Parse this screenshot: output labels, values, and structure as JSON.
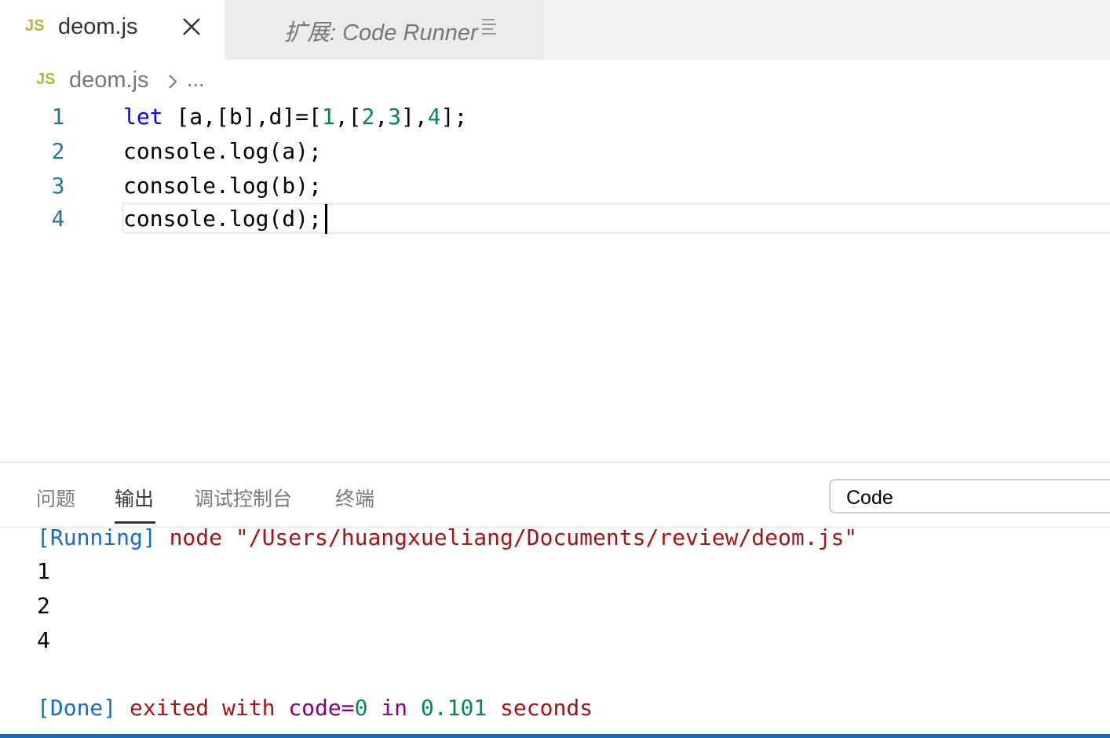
{
  "tabs": [
    {
      "badge": "JS",
      "label": "deom.js",
      "active": true
    },
    {
      "label": "扩展: Code Runner",
      "active": false,
      "icon": "preview-icon"
    }
  ],
  "breadcrumb": {
    "badge": "JS",
    "file": "deom.js",
    "more": "..."
  },
  "editor": {
    "lines": [
      {
        "number": "1",
        "tokens": [
          {
            "text": "let",
            "kind": "kw"
          },
          {
            "text": " [a,[b],d]=[",
            "kind": "plain"
          },
          {
            "text": "1",
            "kind": "num"
          },
          {
            "text": ",[",
            "kind": "plain"
          },
          {
            "text": "2",
            "kind": "num"
          },
          {
            "text": ",",
            "kind": "plain"
          },
          {
            "text": "3",
            "kind": "num"
          },
          {
            "text": "],",
            "kind": "plain"
          },
          {
            "text": "4",
            "kind": "num"
          },
          {
            "text": "];",
            "kind": "plain"
          }
        ]
      },
      {
        "number": "2",
        "tokens": [
          {
            "text": "console.log(a);",
            "kind": "plain"
          }
        ]
      },
      {
        "number": "3",
        "tokens": [
          {
            "text": "console.log(b);",
            "kind": "plain"
          }
        ]
      },
      {
        "number": "4",
        "tokens": [
          {
            "text": "console.log(d);",
            "kind": "plain"
          }
        ]
      }
    ]
  },
  "panel": {
    "tabs": [
      "问题",
      "输出",
      "调试控制台",
      "终端"
    ],
    "active_tab": "输出",
    "output_channel": "Code"
  },
  "output": {
    "running": {
      "tag": "[Running]",
      "command": " node \"/Users/huangxueliang/Documents/review/deom.js\""
    },
    "results": [
      "1",
      "2",
      "4"
    ],
    "done": [
      {
        "text": "[Done]",
        "kind": "blue"
      },
      {
        "text": " exited with ",
        "kind": "red"
      },
      {
        "text": "code=",
        "kind": "purple"
      },
      {
        "text": "0",
        "kind": "green"
      },
      {
        "text": " in ",
        "kind": "purple"
      },
      {
        "text": "0.101",
        "kind": "green"
      },
      {
        "text": " seconds",
        "kind": "red"
      }
    ]
  },
  "colors": {
    "keyword": "#0000ff",
    "number": "#098658",
    "line_number": "#237893",
    "js_badge": "#b7b23a",
    "status_bar": "#0f6fc7"
  }
}
